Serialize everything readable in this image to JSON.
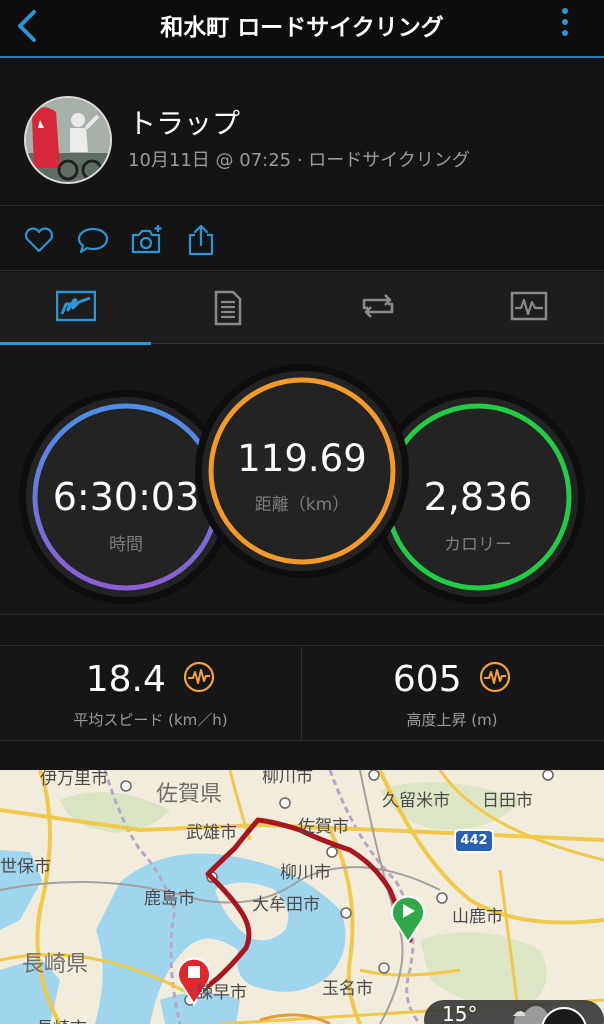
{
  "nav": {
    "title": "和水町 ロードサイクリング"
  },
  "profile": {
    "name": "トラップ",
    "meta": "10月11日 @ 07:25 · ロードサイクリング"
  },
  "actions": [
    "heart-icon",
    "comment-icon",
    "add-photo-icon",
    "share-icon"
  ],
  "tabs": [
    "overview",
    "details",
    "laps",
    "charts"
  ],
  "summary": {
    "time": {
      "value": "6:30:03",
      "label": "時間"
    },
    "distance": {
      "value": "119.69",
      "label": "距離（km）"
    },
    "calories": {
      "value": "2,836",
      "label": "カロリー"
    }
  },
  "stats": {
    "speed": {
      "value": "18.4",
      "label": "平均スピード (km／h)"
    },
    "elevation": {
      "value": "605",
      "label": "高度上昇 (m)"
    }
  },
  "map": {
    "places": [
      "伊万里市",
      "佐賀県",
      "柳川市",
      "久留米市",
      "日田市",
      "佐賀市",
      "武雄市",
      "世保市",
      "柳川市",
      "鹿島市",
      "大牟田市",
      "山鹿市",
      "長崎県",
      "諫早市",
      "玉名市",
      "長崎市"
    ],
    "route_shield": "442",
    "temperature": "15°"
  },
  "colors": {
    "accent": "#2d94d6",
    "time_ring": "#5b8fe0",
    "distance_ring": "#f39a2a",
    "calories_ring": "#22cc44",
    "route": "#a8161e",
    "start_marker": "#2fa84a",
    "end_marker": "#e2262f",
    "gauge": "#f0a33c"
  }
}
